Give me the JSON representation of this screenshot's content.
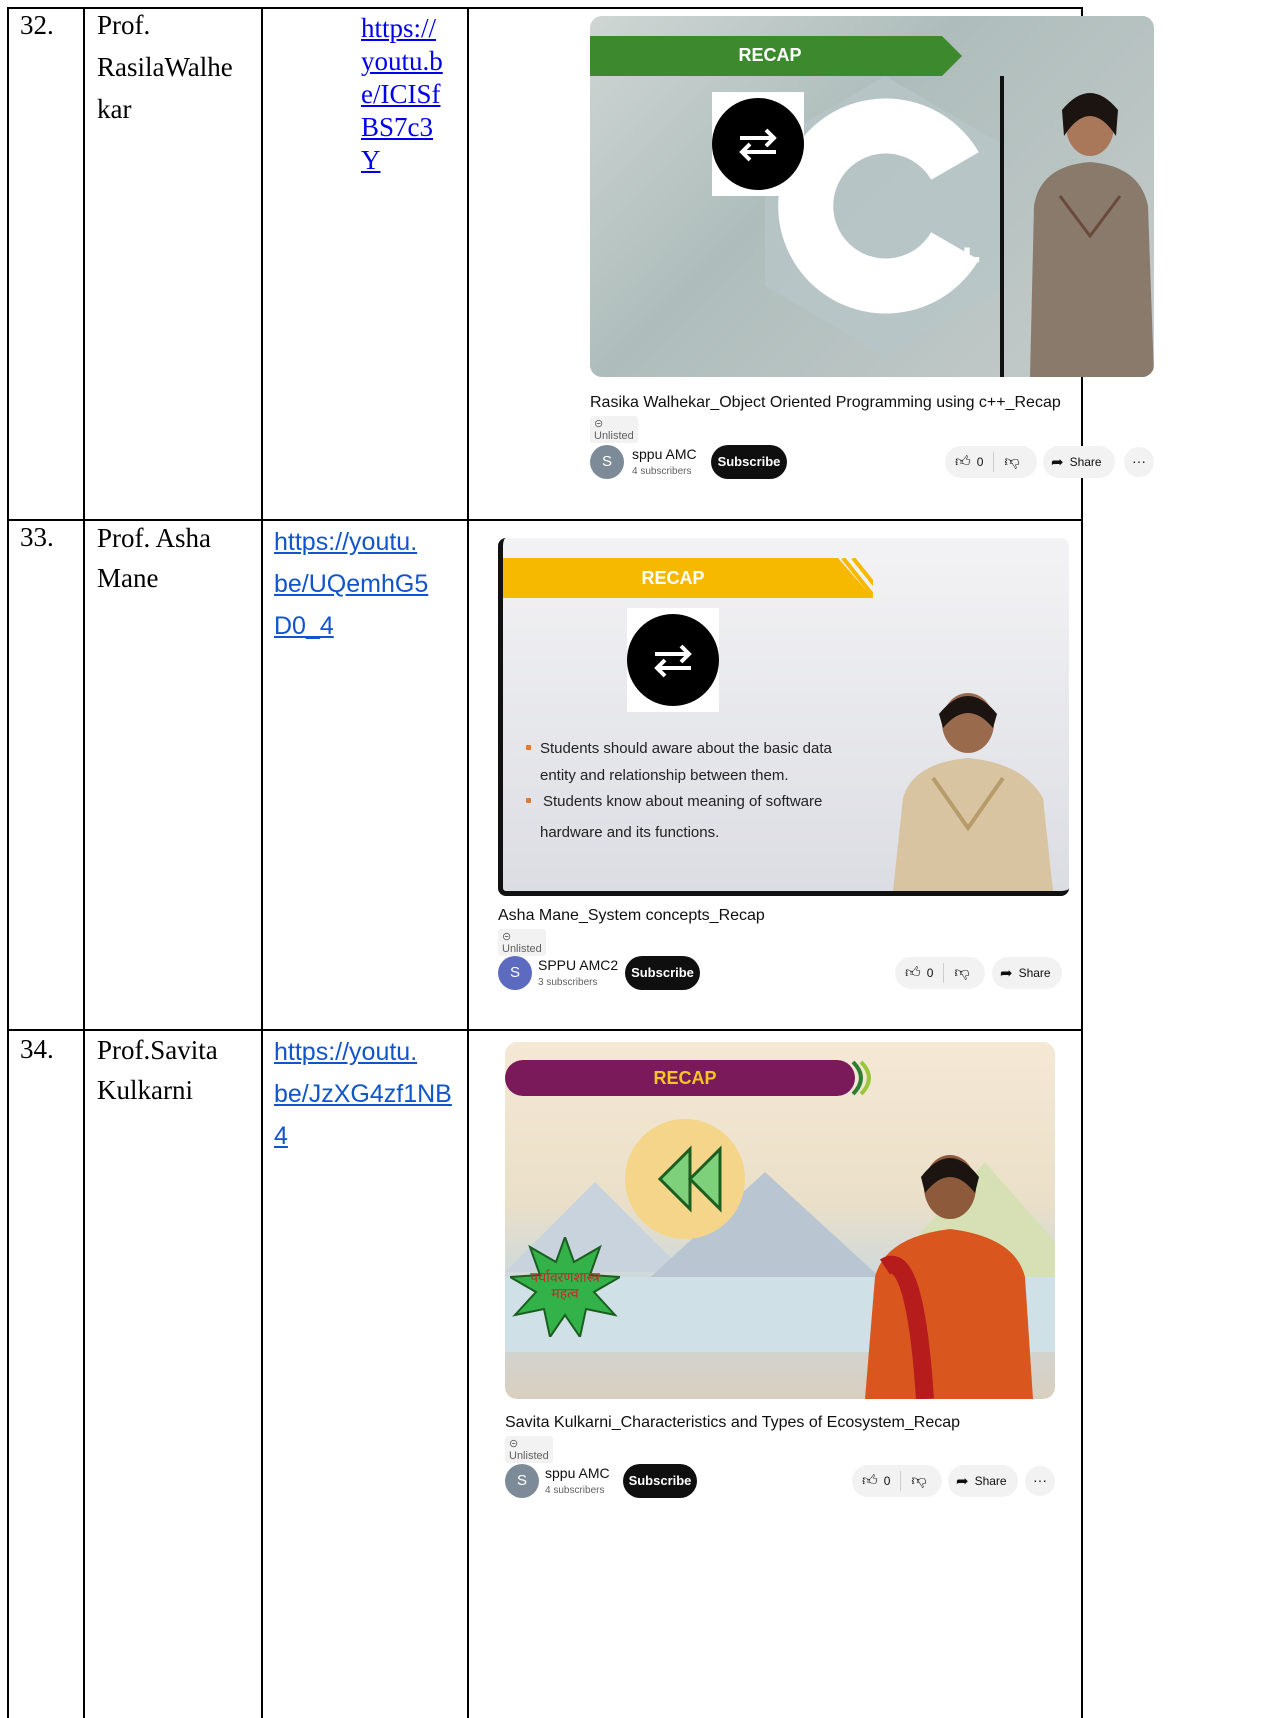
{
  "rows": [
    {
      "sno": "32.",
      "name_lines": [
        "Prof.",
        "RasilaWalhe",
        "kar"
      ],
      "link_lines": [
        "https://",
        "youtu.b",
        "e/ICISf",
        "BS7c3",
        "Y"
      ],
      "video": {
        "banner": "RECAP",
        "title": "Rasika Walhekar_Object Oriented Programming using c++_Recap",
        "unlisted": "Unlisted",
        "avatar_letter": "S",
        "channel": "sppu AMC",
        "subscribers": "4 subscribers",
        "subscribe": "Subscribe",
        "likes": "0",
        "share": "Share",
        "more": "···"
      }
    },
    {
      "sno": "33.",
      "name_lines": [
        "Prof. Asha",
        "Mane"
      ],
      "link_lines": [
        "https://youtu.",
        "be/UQemhG5",
        "D0_4"
      ],
      "video": {
        "banner": "RECAP",
        "bullets": [
          "Students should aware about the basic data",
          "entity and relationship between them.",
          "Students know about meaning of  software",
          "hardware and its functions."
        ],
        "title": "Asha Mane_System concepts_Recap",
        "unlisted": "Unlisted",
        "avatar_letter": "S",
        "channel": "SPPU AMC2",
        "subscribers": "3 subscribers",
        "subscribe": "Subscribe",
        "likes": "0",
        "share": "Share"
      }
    },
    {
      "sno": "34.",
      "name_lines": [
        "Prof.Savita",
        "Kulkarni"
      ],
      "link_lines": [
        "https://youtu.",
        "be/JzXG4zf1NB",
        "4"
      ],
      "video": {
        "banner": "RECAP",
        "badge_lines": [
          "पर्यावरणशास्त्र",
          "महत्व"
        ],
        "title": "Savita Kulkarni_Characteristics and Types of Ecosystem_Recap",
        "unlisted": "Unlisted",
        "avatar_letter": "S",
        "channel": "sppu AMC",
        "subscribers": "4 subscribers",
        "subscribe": "Subscribe",
        "likes": "0",
        "share": "Share",
        "more": "···"
      }
    }
  ],
  "colors": {
    "avatar_row1": "#7c8b97",
    "avatar_row2": "#5c6bc0",
    "avatar_row3": "#7c8b97",
    "banner1": "#3d8a2e",
    "banner2": "#f7b800",
    "banner3": "#7a1a5a"
  }
}
